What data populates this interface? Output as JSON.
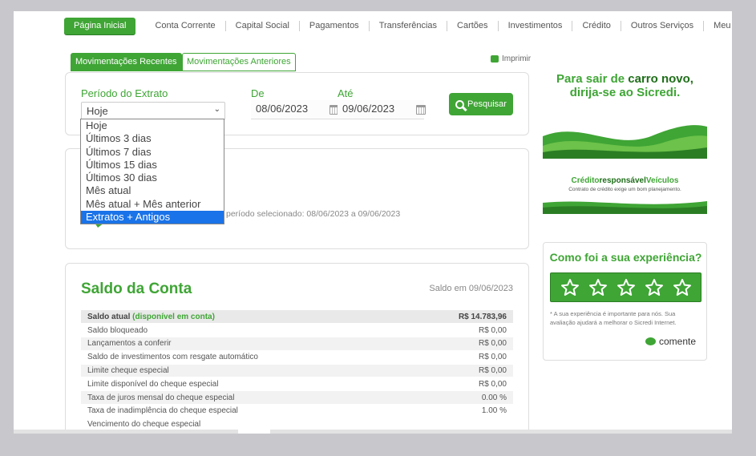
{
  "nav": {
    "items": [
      "Página Inicial",
      "Conta Corrente",
      "Capital Social",
      "Pagamentos",
      "Transferências",
      "Cartões",
      "Investimentos",
      "Crédito",
      "Outros Serviços",
      "Meu Perfil"
    ]
  },
  "tabs": {
    "recent": "Movimentações Recentes",
    "older": "Movimentações Anteriores"
  },
  "print_label": "Imprimir",
  "filter": {
    "period_label": "Período do Extrato",
    "period_value": "Hoje",
    "from_label": "De",
    "from_value": "08/06/2023",
    "to_label": "Até",
    "to_value": "09/06/2023",
    "search_label": "Pesquisar",
    "options": [
      "Hoje",
      "Últimos 3 dias",
      "Últimos 7 dias",
      "Últimos 15 dias",
      "Últimos 30 dias",
      "Mês atual",
      "Mês atual + Mês anterior",
      "Extratos + Antigos"
    ],
    "highlighted_option": "Extratos + Antigos"
  },
  "message": {
    "text": "período selecionado: 08/06/2023 a 09/06/2023"
  },
  "balance": {
    "title": "Saldo da Conta",
    "date": "Saldo em 09/06/2023",
    "head_label": "Saldo atual",
    "head_sub": "(disponível em conta)",
    "head_value": "R$ 14.783,96",
    "rows": [
      {
        "label": "Saldo bloqueado",
        "value": "R$ 0,00"
      },
      {
        "label": "Lançamentos a conferir",
        "value": "R$ 0,00"
      },
      {
        "label": "Saldo de investimentos com resgate automático",
        "value": "R$ 0,00"
      },
      {
        "label": "Limite cheque especial",
        "value": "R$ 0,00"
      },
      {
        "label": "Limite disponível do cheque especial",
        "value": "R$ 0,00"
      },
      {
        "label": "Taxa de juros mensal do cheque especial",
        "value": "0.00 %"
      },
      {
        "label": "Taxa de inadimplência do cheque especial",
        "value": "1.00 %"
      },
      {
        "label": "Vencimento do cheque especial",
        "value": ""
      }
    ]
  },
  "ad": {
    "line1_a": "Para sair de ",
    "line1_b": "carro novo,",
    "line2": "dirija-se ao Sicredi.",
    "t1_a": "Crédito",
    "t1_b": "responsável",
    "t1_c": "Veículos",
    "t2": "Contrato de crédito exige um bom planejamento."
  },
  "feedback": {
    "title": "Como foi a sua experiência?",
    "stars": 5,
    "note": "* A sua experiência é importante para nós. Sua avaliação ajudará a melhorar o Sicredi Internet.",
    "comment_label": "comente"
  },
  "colors": {
    "brand_green": "#3fa535",
    "dark_green": "#1f6e1a",
    "selection_blue": "#1a73e8"
  }
}
